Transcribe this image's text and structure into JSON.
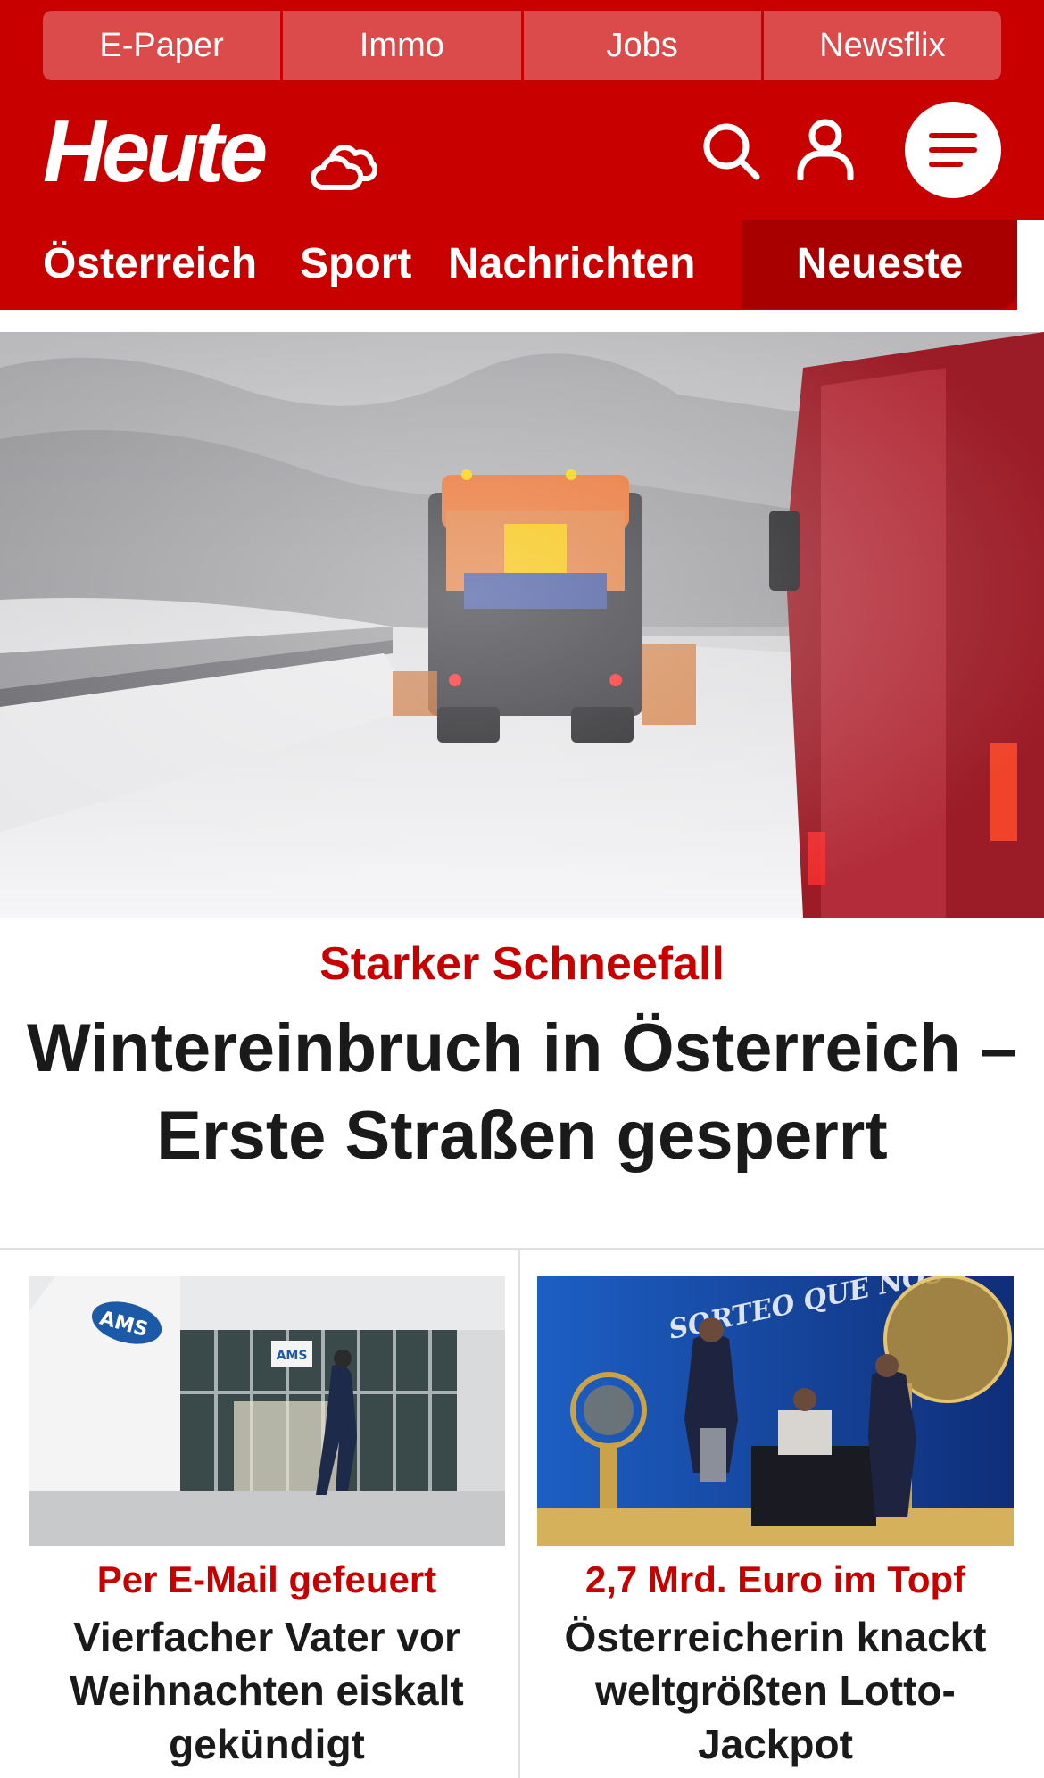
{
  "topbar": {
    "items": [
      {
        "label": "E-Paper"
      },
      {
        "label": "Immo"
      },
      {
        "label": "Jobs"
      },
      {
        "label": "Newsflix"
      }
    ]
  },
  "header": {
    "logo_text": "Heute",
    "icons": [
      "cloud-weather-icon",
      "search-icon",
      "user-icon",
      "menu-icon"
    ]
  },
  "nav": {
    "items": [
      {
        "label": "Österreich"
      },
      {
        "label": "Sport"
      },
      {
        "label": "Nachrichten"
      }
    ],
    "active_label": "Neueste"
  },
  "hero": {
    "kicker": "Starker Schneefall",
    "title": "Wintereinbruch in Österreich – Erste Straßen gesperrt"
  },
  "cards": [
    {
      "kicker": "Per E-Mail gefeuert",
      "title": "Vierfacher Vater vor Weihnachten eiskalt gekündigt",
      "image_sign": "AMS"
    },
    {
      "kicker": "2,7 Mrd. Euro im Topf",
      "title": "Österreicherin knackt weltgrößten Lotto-Jackpot",
      "image_sign": "SORTEO QUE NOS UNE"
    }
  ],
  "colors": {
    "brand_red": "#c80000",
    "topbar_item": "#db4b4b",
    "nav_active": "#a80000",
    "text_dark": "#1a1a1a"
  }
}
